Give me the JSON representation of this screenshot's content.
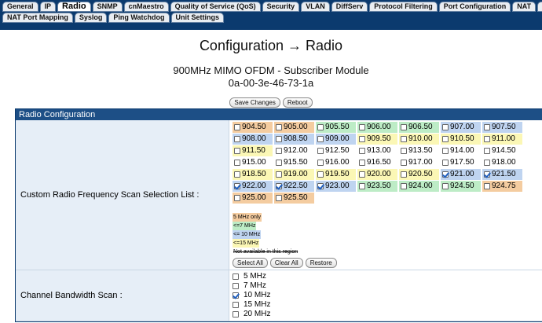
{
  "tabs_row1": [
    "General",
    "IP",
    "Radio",
    "SNMP",
    "cnMaestro",
    "Quality of Service (QoS)",
    "Security",
    "VLAN",
    "DiffServ",
    "Protocol Filtering",
    "Port Configuration",
    "NAT",
    "PP"
  ],
  "tabs_row2": [
    "NAT Port Mapping",
    "Syslog",
    "Ping Watchdog",
    "Unit Settings"
  ],
  "active_tab": "Radio",
  "page": {
    "title": "Configuration → Radio",
    "device": "900MHz MIMO OFDM - Subscriber Module",
    "mac": "0a-00-3e-46-73-1a",
    "save_label": "Save Changes",
    "reboot_label": "Reboot"
  },
  "section": {
    "title": "Radio Configuration",
    "scan_label": "Custom Radio Frequency Scan Selection List :",
    "bandwidth_label": "Channel Bandwidth Scan :"
  },
  "frequencies": [
    {
      "f": "904.50",
      "c": "orange",
      "checked": false
    },
    {
      "f": "905.00",
      "c": "orange",
      "checked": false
    },
    {
      "f": "905.50",
      "c": "green",
      "checked": false
    },
    {
      "f": "906.00",
      "c": "green",
      "checked": false
    },
    {
      "f": "906.50",
      "c": "green",
      "checked": false
    },
    {
      "f": "907.00",
      "c": "blue",
      "checked": false
    },
    {
      "f": "907.50",
      "c": "blue",
      "checked": false
    },
    {
      "f": "908.00",
      "c": "blue",
      "checked": false
    },
    {
      "f": "908.50",
      "c": "blue",
      "checked": false
    },
    {
      "f": "909.00",
      "c": "blue",
      "checked": false
    },
    {
      "f": "909.50",
      "c": "yellow",
      "checked": false
    },
    {
      "f": "910.00",
      "c": "yellow",
      "checked": false
    },
    {
      "f": "910.50",
      "c": "yellow",
      "checked": false
    },
    {
      "f": "911.00",
      "c": "yellow",
      "checked": false
    },
    {
      "f": "911.50",
      "c": "yellow",
      "checked": false
    },
    {
      "f": "912.00",
      "c": "none",
      "checked": false
    },
    {
      "f": "912.50",
      "c": "none",
      "checked": false
    },
    {
      "f": "913.00",
      "c": "none",
      "checked": false
    },
    {
      "f": "913.50",
      "c": "none",
      "checked": false
    },
    {
      "f": "914.00",
      "c": "none",
      "checked": false
    },
    {
      "f": "914.50",
      "c": "none",
      "checked": false
    },
    {
      "f": "915.00",
      "c": "none",
      "checked": false
    },
    {
      "f": "915.50",
      "c": "none",
      "checked": false
    },
    {
      "f": "916.00",
      "c": "none",
      "checked": false
    },
    {
      "f": "916.50",
      "c": "none",
      "checked": false
    },
    {
      "f": "917.00",
      "c": "none",
      "checked": false
    },
    {
      "f": "917.50",
      "c": "none",
      "checked": false
    },
    {
      "f": "918.00",
      "c": "none",
      "checked": false
    },
    {
      "f": "918.50",
      "c": "yellow",
      "checked": false
    },
    {
      "f": "919.00",
      "c": "yellow",
      "checked": false
    },
    {
      "f": "919.50",
      "c": "yellow",
      "checked": false
    },
    {
      "f": "920.00",
      "c": "yellow",
      "checked": false
    },
    {
      "f": "920.50",
      "c": "yellow",
      "checked": false
    },
    {
      "f": "921.00",
      "c": "blue",
      "checked": true
    },
    {
      "f": "921.50",
      "c": "blue",
      "checked": true
    },
    {
      "f": "922.00",
      "c": "blue",
      "checked": true
    },
    {
      "f": "922.50",
      "c": "blue",
      "checked": true
    },
    {
      "f": "923.00",
      "c": "blue",
      "checked": true
    },
    {
      "f": "923.50",
      "c": "green",
      "checked": false
    },
    {
      "f": "924.00",
      "c": "green",
      "checked": false
    },
    {
      "f": "924.50",
      "c": "green",
      "checked": false
    },
    {
      "f": "924.75",
      "c": "orange",
      "checked": false
    },
    {
      "f": "925.00",
      "c": "orange",
      "checked": false
    },
    {
      "f": "925.50",
      "c": "orange",
      "checked": false
    }
  ],
  "legend": [
    {
      "text": "5 MHz only",
      "c": "orange"
    },
    {
      "text": "<=7 MHz",
      "c": "green"
    },
    {
      "text": "<= 10 MHz",
      "c": "blue"
    },
    {
      "text": "<=15 MHz",
      "c": "yellow"
    },
    {
      "text": "Not available in this region",
      "c": "none",
      "strike": true
    }
  ],
  "list_buttons": {
    "select_all": "Select All",
    "clear_all": "Clear All",
    "restore": "Restore"
  },
  "bandwidths": [
    {
      "label": "5 MHz",
      "checked": false
    },
    {
      "label": "7 MHz",
      "checked": false
    },
    {
      "label": "10 MHz",
      "checked": true
    },
    {
      "label": "15 MHz",
      "checked": false
    },
    {
      "label": "20 MHz",
      "checked": false
    }
  ],
  "colors": {
    "orange": "#f4cca0",
    "green": "#bdecc6",
    "blue": "#bfd4f0",
    "yellow": "#fbf7b5",
    "nav_bg": "#0b3a6e",
    "section_header": "#1d4f86"
  }
}
